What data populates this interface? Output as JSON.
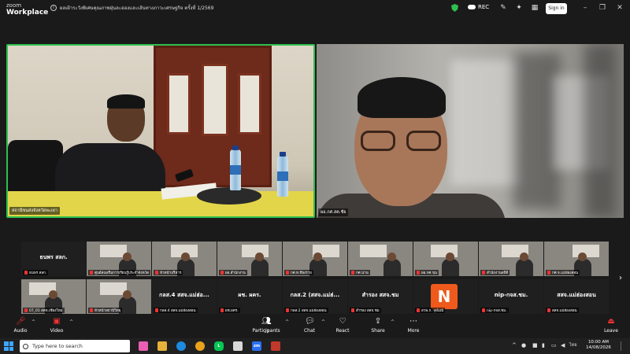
{
  "titlebar": {
    "brand_line1": "zoom",
    "brand_line2": "Workplace",
    "meeting_title": "ผลเฝ้าระวังพิเศษคุณภาพฝุ่นละอองและเส้นทางภาวะเศรษฐกิจ ครั้งที่ 1/2569",
    "rec_label": "REC",
    "signin_label": "Sign in"
  },
  "main_video": [
    {
      "name": "สถานีขนส่งจังหวัดพะเยา"
    },
    {
      "name": "ผอ.กศ.สต.ชัย"
    }
  ],
  "gallery": {
    "row1": [
      {
        "name": "ธนพร สลก.",
        "label": "ธนพร สลก.",
        "video": false
      },
      {
        "name": "ศูนย์ส่งเสริมการเรียนรู้ประจำจังหวัด",
        "video": true
      },
      {
        "name": "หัวหน้าบริหาร",
        "video": true
      },
      {
        "name": "ผอ.สำนักงาน",
        "video": true
      },
      {
        "name": "กศ.ท.ชียงราย",
        "video": true
      },
      {
        "name": "กศ.น่าน",
        "video": true
      },
      {
        "name": "ผอ.กศ.ขุน",
        "video": true
      },
      {
        "name": "สำนักงานสถิติ",
        "video": true
      },
      {
        "name": "กศ.จ.แม่ฮ่องสอน",
        "video": true
      }
    ],
    "row2": [
      {
        "name": "07_01 สคจ.เชียงใหม่",
        "video": true
      },
      {
        "name": "หัวหน้าสถานีวิทยุ",
        "video": true
      },
      {
        "name": "กลส.4 สสจ.แม่ฮ่องสอน",
        "label": "กลส.4 สสจ.แม่ฮ่อ...",
        "video": false
      },
      {
        "name": "ผช.ผคร.",
        "label": "ผช. ผคร.",
        "video": false
      },
      {
        "name": "กลส.2 สสจ.แม่ฮ่องสอน",
        "label": "กลส.2 (สสจ.แม่ฮ่...",
        "video": false
      },
      {
        "name": "สำรอง สสจ.ชม",
        "label": "สำรอง สสจ.ชม",
        "video": false
      },
      {
        "name": "สวพ.ก. จุฬมณี",
        "label": "N",
        "video": false,
        "avatar": true
      },
      {
        "name": "nip-กจส.ชม.",
        "label": "nip-กจส.ชม.",
        "video": false
      },
      {
        "name": "สสจ.แม่ฮ่องสอน",
        "label": "สสจ.แม่ฮ่องสอน",
        "video": false
      }
    ]
  },
  "toolbar": {
    "audio": "Audio",
    "video": "Video",
    "participants": "Participants",
    "participants_count": "23",
    "chat": "Chat",
    "react": "React",
    "share": "Share",
    "more": "More",
    "leave": "Leave"
  },
  "taskbar": {
    "search_placeholder": "Type here to search",
    "lang": "ไทย",
    "time": "10:00 AM",
    "date": "14/08/2026"
  },
  "colors": {
    "active_speaker": "#2fbf4f",
    "leave_red": "#e33",
    "avatar_orange": "#ef5a1c"
  }
}
